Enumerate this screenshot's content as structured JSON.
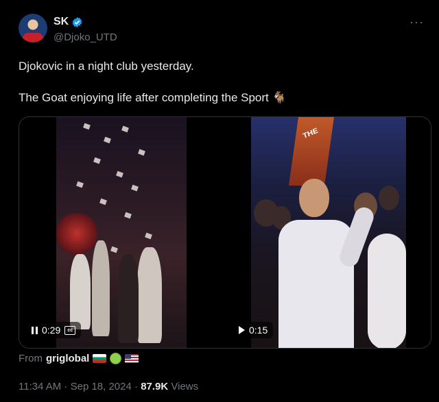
{
  "author": {
    "name": "SK",
    "handle": "@Djoko_UTD",
    "verified": true
  },
  "tweet": {
    "line1": "Djokovic in a night club yesterday.",
    "line2": "The Goat enjoying life after completing the Sport 🐐"
  },
  "media": {
    "video1": {
      "time": "0:29",
      "state": "playing",
      "icons": [
        "pause-icon",
        "captions-icon"
      ]
    },
    "video2": {
      "time": "0:15",
      "state": "paused",
      "icons": [
        "play-icon"
      ]
    }
  },
  "source": {
    "prefix": "From",
    "name": "griglobal",
    "icons": [
      "bulgaria-flag-icon",
      "tennis-ball-icon",
      "us-flag-icon"
    ]
  },
  "meta": {
    "datetime": "11:34 AM · Sep 18, 2024 ·",
    "views_count": "87.9K",
    "views_label": "Views"
  },
  "colors": {
    "background": "#000000",
    "text": "#e7e9ea",
    "muted": "#71767b",
    "verified": "#1d9bf0"
  }
}
